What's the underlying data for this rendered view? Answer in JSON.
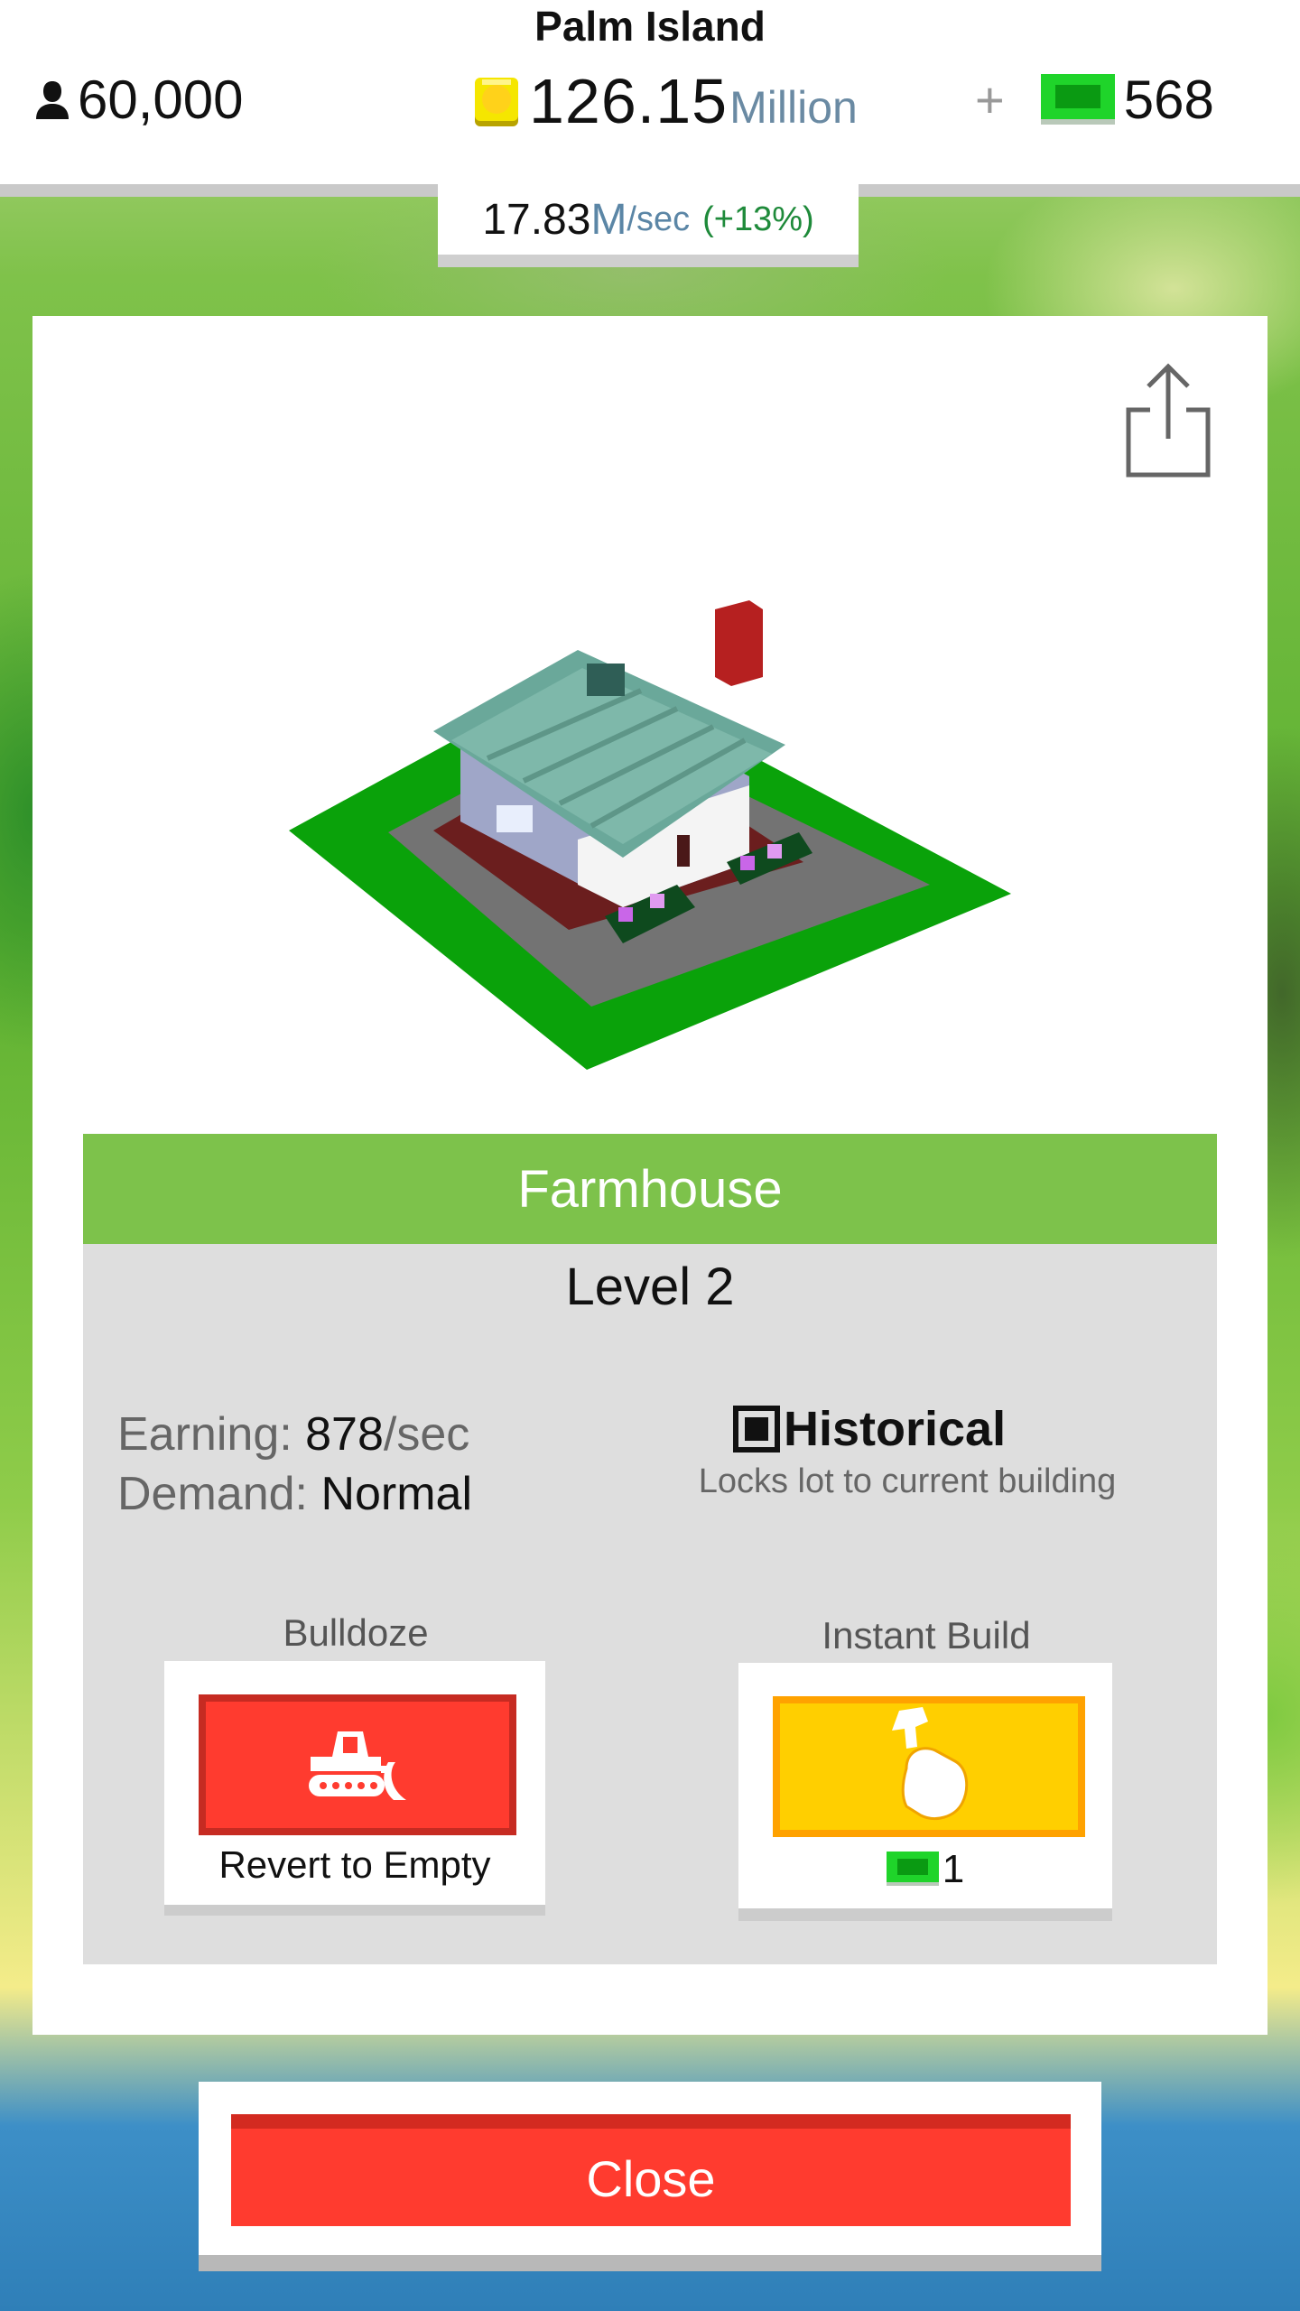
{
  "header": {
    "city_name": "Palm Island",
    "population": "60,000",
    "coins": "126.15",
    "coins_unit": "Million",
    "plus": "+",
    "bux": "568"
  },
  "income": {
    "value": "17.83",
    "unit": "M",
    "per": "/sec",
    "bonus": "(+13%)"
  },
  "building": {
    "name": "Farmhouse",
    "level": "Level 2",
    "earning_label": "Earning:",
    "earning_value": "878",
    "earning_per": "/sec",
    "demand_label": "Demand:",
    "demand_value": "Normal",
    "historical_label": "Historical",
    "historical_checked": true,
    "historical_desc": "Locks lot to current building"
  },
  "actions": {
    "bulldoze_title": "Bulldoze",
    "bulldoze_label": "Revert to Empty",
    "instant_title": "Instant Build",
    "instant_cost": "1"
  },
  "close_label": "Close",
  "icons": {
    "population": "person-icon",
    "coins": "coin-icon",
    "bux": "bux-icon",
    "share": "share-icon",
    "bulldozer": "bulldozer-icon",
    "instant": "hammer-hand-icon"
  },
  "colors": {
    "name_bar": "#7dc24b",
    "bulldoze": "#ff3b2f",
    "instant": "#ffcf00",
    "bux": "#1fcf2a",
    "close": "#ff3b2f"
  }
}
